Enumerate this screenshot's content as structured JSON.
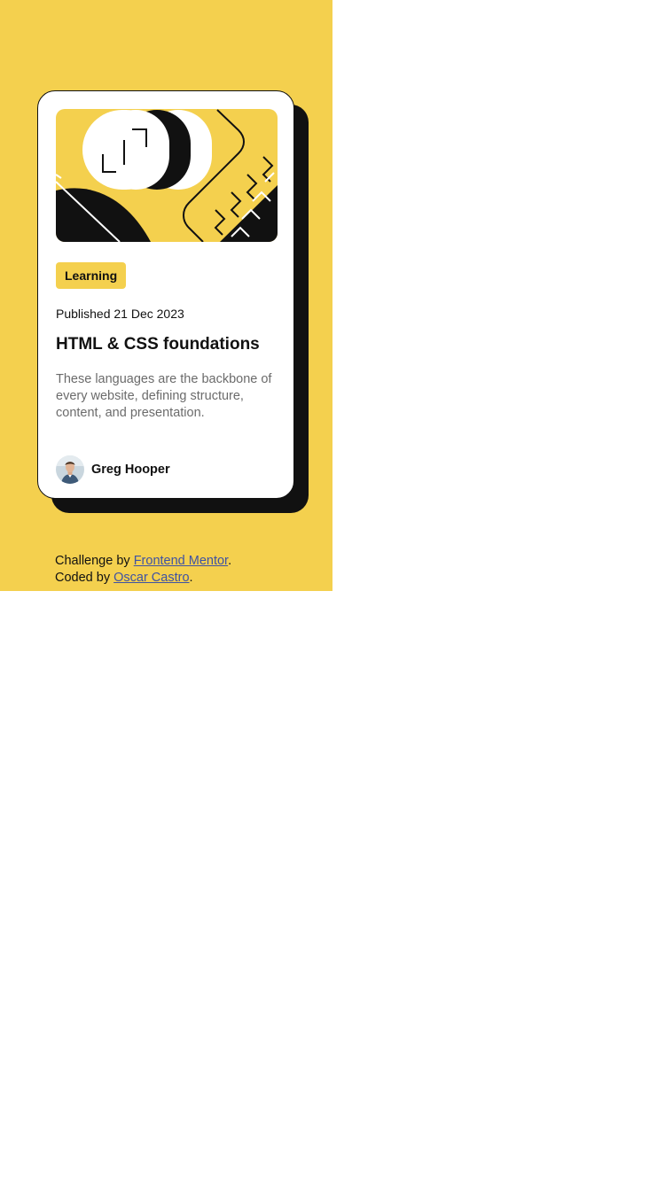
{
  "colors": {
    "background": "#F4D04E",
    "card": "#FFFFFF",
    "ink": "#111111",
    "muted_text": "#6B6B6B",
    "link": "#3E52A3"
  },
  "card": {
    "hero_image": "illustration-article",
    "category": "Learning",
    "published": "Published 21 Dec 2023",
    "title": "HTML & CSS foundations",
    "description": "These languages are the backbone of every website, defining structure, content, and presentation.",
    "author": {
      "avatar": "image-avatar",
      "name": "Greg Hooper"
    }
  },
  "attribution": {
    "challenge_prefix": "Challenge by",
    "challenge_link": "Frontend Mentor",
    "coded_prefix": "Coded by",
    "coded_link": "Oscar Castro",
    "period": "."
  }
}
